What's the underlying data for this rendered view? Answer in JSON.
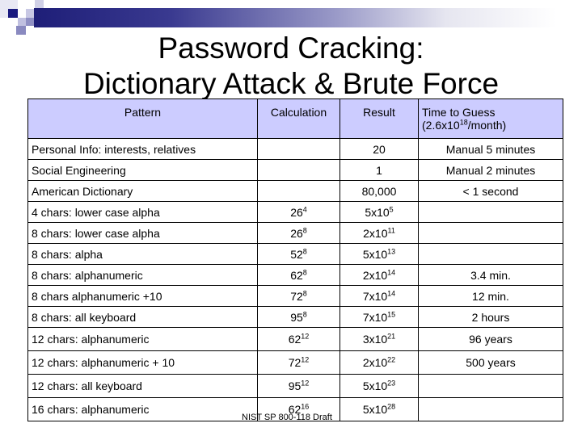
{
  "slide": {
    "title_line1": "Password Cracking:",
    "title_line2": "Dictionary Attack & Brute Force",
    "accent_colors": {
      "banner_dark": "#1e1e78",
      "header_fill": "#ccccff"
    }
  },
  "table": {
    "headers": {
      "pattern": "Pattern",
      "calculation": "Calculation",
      "result": "Result",
      "time": "Time to Guess",
      "time_rate_base": "(2.6x10",
      "time_rate_exp": "18",
      "time_rate_tail": "/month)"
    },
    "rows": [
      {
        "pattern": "Personal Info: interests, relatives",
        "calc_base": "",
        "calc_exp": "",
        "result_base": "20",
        "result_exp": "",
        "time": "Manual 5 minutes"
      },
      {
        "pattern": "Social Engineering",
        "calc_base": "",
        "calc_exp": "",
        "result_base": "1",
        "result_exp": "",
        "time": "Manual 2 minutes"
      },
      {
        "pattern": "American Dictionary",
        "calc_base": "",
        "calc_exp": "",
        "result_base": "80,000",
        "result_exp": "",
        "time": "< 1 second"
      },
      {
        "pattern": "4 chars: lower case alpha",
        "calc_base": "26",
        "calc_exp": "4",
        "result_base": "5x10",
        "result_exp": "5",
        "time": ""
      },
      {
        "pattern": "8 chars: lower case alpha",
        "calc_base": "26",
        "calc_exp": "8",
        "result_base": "2x10",
        "result_exp": "11",
        "time": ""
      },
      {
        "pattern": "8 chars: alpha",
        "calc_base": "52",
        "calc_exp": "8",
        "result_base": "5x10",
        "result_exp": "13",
        "time": ""
      },
      {
        "pattern": "8 chars: alphanumeric",
        "calc_base": "62",
        "calc_exp": "8",
        "result_base": "2x10",
        "result_exp": "14",
        "time": "3.4 min."
      },
      {
        "pattern": "8 chars alphanumeric +10",
        "calc_base": "72",
        "calc_exp": "8",
        "result_base": "7x10",
        "result_exp": "14",
        "time": "12 min."
      },
      {
        "pattern": "8 chars: all keyboard",
        "calc_base": "95",
        "calc_exp": "8",
        "result_base": "7x10",
        "result_exp": "15",
        "time": "2 hours"
      },
      {
        "pattern": "12 chars: alphanumeric",
        "calc_base": "62",
        "calc_exp": "12",
        "result_base": "3x10",
        "result_exp": "21",
        "time": "96 years"
      },
      {
        "pattern": "12 chars: alphanumeric + 10",
        "calc_base": "72",
        "calc_exp": "12",
        "result_base": "2x10",
        "result_exp": "22",
        "time": "500 years"
      },
      {
        "pattern": "12 chars: all keyboard",
        "calc_base": "95",
        "calc_exp": "12",
        "result_base": "5x10",
        "result_exp": "23",
        "time": ""
      },
      {
        "pattern": "16 chars: alphanumeric",
        "calc_base": "62",
        "calc_exp": "16",
        "result_base": "5x10",
        "result_exp": "28",
        "time": ""
      }
    ]
  },
  "footer": {
    "source_note": "NIST SP 800-118 Draft"
  }
}
